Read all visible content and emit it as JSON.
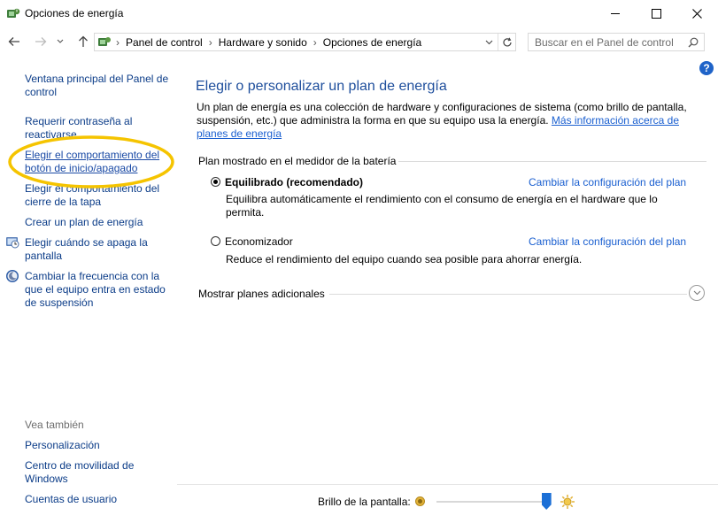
{
  "window": {
    "title": "Opciones de energía"
  },
  "nav": {
    "breadcrumb": [
      "Panel de control",
      "Hardware y sonido",
      "Opciones de energía"
    ],
    "search_placeholder": "Buscar en el Panel de control"
  },
  "sidebar": {
    "links": [
      {
        "label": "Ventana principal del Panel de control"
      },
      {
        "label": "Requerir contraseña al reactivarse"
      },
      {
        "label": "Elegir el comportamiento del botón de inicio/apagado"
      },
      {
        "label": "Elegir el comportamiento del cierre de la tapa"
      },
      {
        "label": "Crear un plan de energía"
      },
      {
        "label": "Elegir cuándo se apaga la pantalla"
      },
      {
        "label": "Cambiar la frecuencia con la que el equipo entra en estado de suspensión"
      }
    ],
    "see_also_title": "Vea también",
    "see_also": [
      {
        "label": "Personalización"
      },
      {
        "label": "Centro de movilidad de Windows"
      },
      {
        "label": "Cuentas de usuario"
      }
    ]
  },
  "main": {
    "title": "Elegir o personalizar un plan de energía",
    "description": "Un plan de energía es una colección de hardware y configuraciones de sistema (como brillo de pantalla, suspensión, etc.) que administra la forma en que su equipo usa la energía.",
    "more_info_link": "Más información acerca de planes de energía",
    "battery_meter_label": "Plan mostrado en el medidor de la batería",
    "plans": [
      {
        "name": "Equilibrado (recomendado)",
        "selected": true,
        "description": "Equilibra automáticamente el rendimiento con el consumo de energía en el hardware que lo permita.",
        "change_link": "Cambiar la configuración del plan"
      },
      {
        "name": "Economizador",
        "selected": false,
        "description": "Reduce el rendimiento del equipo cuando sea posible para ahorrar energía.",
        "change_link": "Cambiar la configuración del plan"
      }
    ],
    "show_more_label": "Mostrar planes adicionales"
  },
  "brightness": {
    "label": "Brillo de la pantalla:",
    "level": 0.97
  },
  "colors": {
    "link": "#1a5fd0",
    "title": "#1e4e9c",
    "highlight_circle": "#f5c400"
  }
}
